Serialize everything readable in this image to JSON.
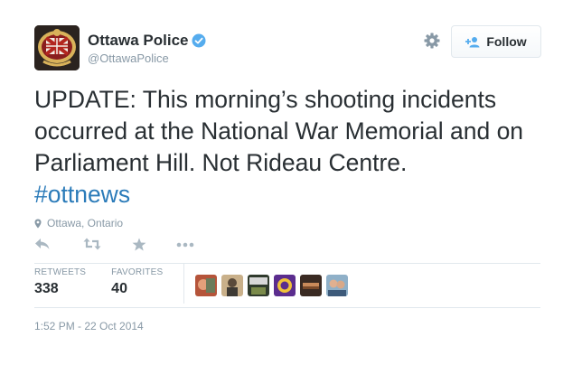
{
  "user": {
    "display_name": "Ottawa Police",
    "handle": "@OttawaPolice"
  },
  "follow_label": "Follow",
  "tweet": {
    "text": "UPDATE: This morning’s shooting incidents occurred at the National War Memorial and on Parliament Hill.  Not Rideau Centre.",
    "hashtag": "#ottnews",
    "location": "Ottawa, Ontario",
    "timestamp": "1:52 PM - 22 Oct 2014"
  },
  "stats": {
    "retweets_label": "RETWEETS",
    "retweets_value": "338",
    "favorites_label": "FAVORITES",
    "favorites_value": "40"
  },
  "icons": {
    "verified": "verified-badge-icon",
    "gear": "gear-icon",
    "follow": "add-user-icon",
    "location": "location-pin-icon",
    "reply": "reply-icon",
    "retweet": "retweet-icon",
    "favorite": "star-icon",
    "more": "more-dots-icon"
  },
  "colors": {
    "accent": "#2b7bb9",
    "verified": "#55acee",
    "muted": "#8899a6",
    "text": "#292f33"
  }
}
